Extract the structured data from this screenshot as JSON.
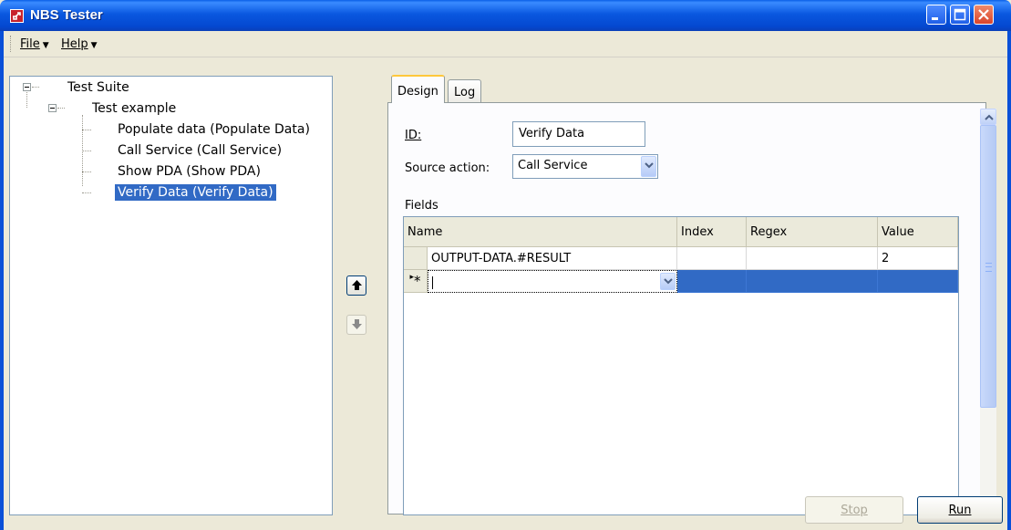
{
  "window": {
    "title": "NBS Tester",
    "icon": "app-arrow-icon",
    "controls": [
      "minimize-icon",
      "maximize-icon",
      "close-icon"
    ]
  },
  "menu": {
    "file": "File",
    "help": "Help"
  },
  "tree": {
    "root": "Test Suite",
    "child": "Test example",
    "items": [
      "Populate data (Populate Data)",
      "Call Service (Call Service)",
      "Show PDA (Show PDA)",
      "Verify Data (Verify Data)"
    ],
    "selected_index": 3
  },
  "move_buttons": {
    "up_icon": "arrow-up-icon",
    "down_icon": "arrow-down-icon"
  },
  "tabs": {
    "design": "Design",
    "log": "Log",
    "active": "Design"
  },
  "form": {
    "id_label": "ID:",
    "id_value": "Verify Data",
    "source_label": "Source action:",
    "source_value": "Call Service",
    "fields_label": "Fields"
  },
  "grid": {
    "columns": [
      "Name",
      "Index",
      "Regex",
      "Value"
    ],
    "rows": [
      {
        "name": "OUTPUT-DATA.#RESULT",
        "index": "",
        "regex": "",
        "value": "2"
      }
    ],
    "new_row_marker": "*"
  },
  "buttons": {
    "stop": "Stop",
    "run": "Run"
  },
  "colors": {
    "title_bar": "#0a58e0",
    "selection": "#316ac5",
    "window_bg": "#ece9d8"
  }
}
